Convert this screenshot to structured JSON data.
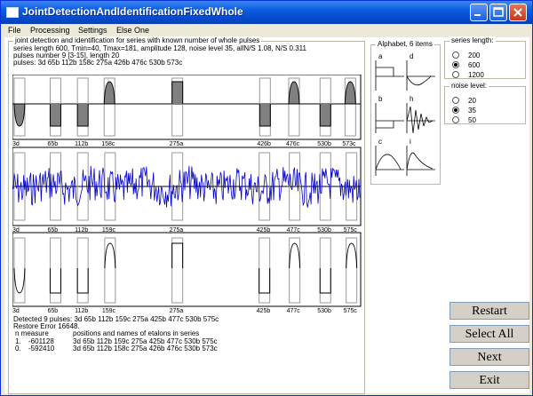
{
  "window": {
    "title": "JointDetectionAndIdentificationFixedWhole"
  },
  "menu": [
    "File",
    "Processing",
    "Settings",
    "Else One"
  ],
  "main_group": {
    "title": "joint detection and identification for series with known number of whole pulses",
    "line1": "series length 600, Tmin=40, Tmax=181,  amplitude 128, noise level 35, allN/S 1.08,  N/S 0.311",
    "line2": "pulses number 9 [3-15], length 20",
    "line3": "pulses: 3d 65b 112b 158c 275a 426b 476c 530b 573c"
  },
  "plots": {
    "top_labels": [
      "3d",
      "65b",
      "112b",
      "158c",
      "275a",
      "426b",
      "476c",
      "530b",
      "573c"
    ],
    "middle_labels": [
      "3d",
      "65b",
      "112b",
      "159c",
      "275a",
      "425b",
      "477c",
      "530b",
      "575c"
    ],
    "bottom_labels": [
      "3d",
      "65b",
      "112b",
      "159c",
      "275a",
      "425b",
      "477c",
      "530b",
      "575c"
    ]
  },
  "results": {
    "detected": "Detected 9 pulses:  3d 65b 112b 159c 275a 425b 477c 530b 575c",
    "restore_error": "Restore Error 16648.",
    "header_n": "n  measure",
    "header_positions": "positions and names of etalons in series",
    "rows": [
      {
        "n": "1.",
        "measure": "-601128",
        "positions": "3d  65b  112b  159c  275a  425b  477c  530b  575c"
      },
      {
        "n": "0.",
        "measure": "-592410",
        "positions": "3d  65b  112b  158c  275a  426b  476c  530b  573c"
      }
    ]
  },
  "alphabet": {
    "title": "Alphabet, 6 items",
    "letters": [
      "a",
      "d",
      "b",
      "h",
      "c",
      "i"
    ]
  },
  "series_length": {
    "title": "series length:",
    "options": [
      "200",
      "600",
      "1200"
    ],
    "selected": 1
  },
  "noise_level": {
    "title": "noise level:",
    "options": [
      "20",
      "35",
      "50"
    ],
    "selected": 1
  },
  "buttons": {
    "restart": "Restart",
    "select_all": "Select All",
    "next": "Next",
    "exit": "Exit"
  },
  "colors": {
    "signal": "#0000c8",
    "pulse_fill": "#808080",
    "titlebar": "#0a5ce0"
  }
}
